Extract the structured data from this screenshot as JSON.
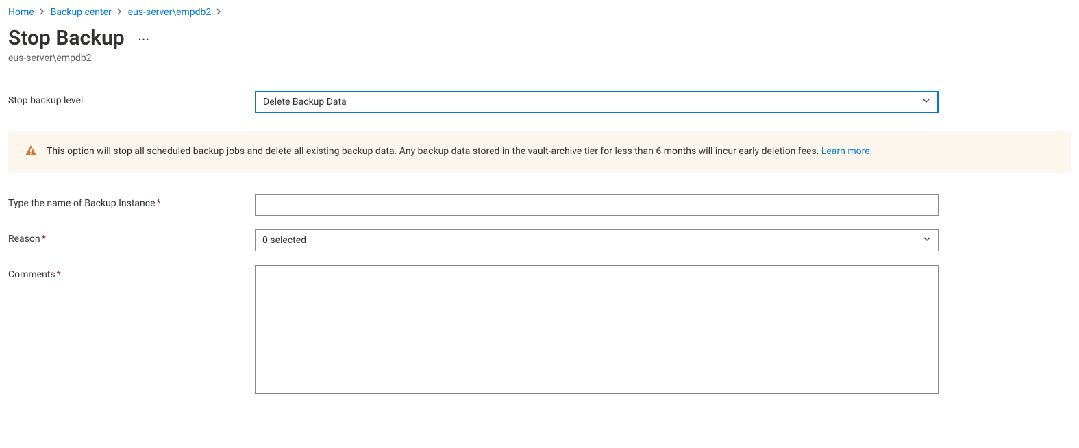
{
  "breadcrumb": {
    "items": [
      {
        "label": "Home"
      },
      {
        "label": "Backup center"
      },
      {
        "label": "eus-server\\empdb2"
      }
    ]
  },
  "header": {
    "title": "Stop Backup",
    "subtitle": "eus-server\\empdb2"
  },
  "form": {
    "stopLevel": {
      "label": "Stop backup level",
      "value": "Delete Backup Data"
    },
    "warning": {
      "text": "This option will stop all scheduled backup jobs and delete all existing backup data. Any backup data stored in the vault-archive tier for less than 6 months will incur early deletion fees. ",
      "link": "Learn more."
    },
    "instanceName": {
      "label": "Type the name of Backup Instance",
      "value": ""
    },
    "reason": {
      "label": "Reason",
      "value": "0 selected"
    },
    "comments": {
      "label": "Comments",
      "value": ""
    }
  }
}
